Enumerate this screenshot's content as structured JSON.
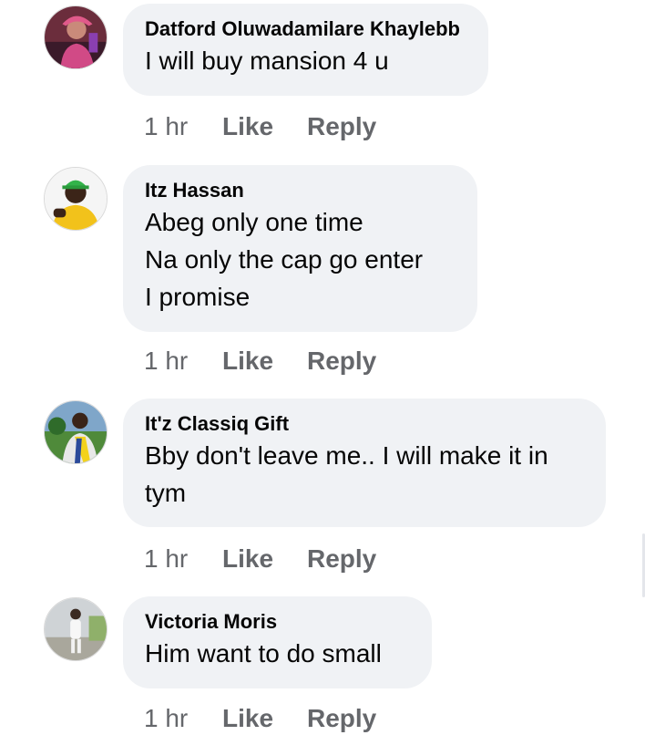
{
  "comments": [
    {
      "author": "Datford Oluwadamilare Khaylebb",
      "lines": [
        "I will buy mansion 4 u"
      ],
      "time": "1 hr",
      "like_label": "Like",
      "reply_label": "Reply",
      "avatar_icon": "profile-photo-person-pink-hat"
    },
    {
      "author": "Itz Hassan",
      "lines": [
        "Abeg only one time",
        "Na only the cap go enter",
        "I promise"
      ],
      "time": "1 hr",
      "like_label": "Like",
      "reply_label": "Reply",
      "avatar_icon": "profile-photo-person-green-cap"
    },
    {
      "author": "It'z Classiq Gift",
      "lines": [
        "Bby don't leave me.. I will make it in",
        "tym"
      ],
      "time": "1 hr",
      "like_label": "Like",
      "reply_label": "Reply",
      "avatar_icon": "profile-photo-person-outdoors"
    },
    {
      "author": "Victoria Moris",
      "lines": [
        "Him want to do small"
      ],
      "time": "1 hr",
      "like_label": "Like",
      "reply_label": "Reply",
      "avatar_icon": "profile-photo-person-standing"
    }
  ],
  "colors": {
    "bubble_bg": "#f0f2f5",
    "author_text": "#050505",
    "meta_text": "#65676b"
  }
}
